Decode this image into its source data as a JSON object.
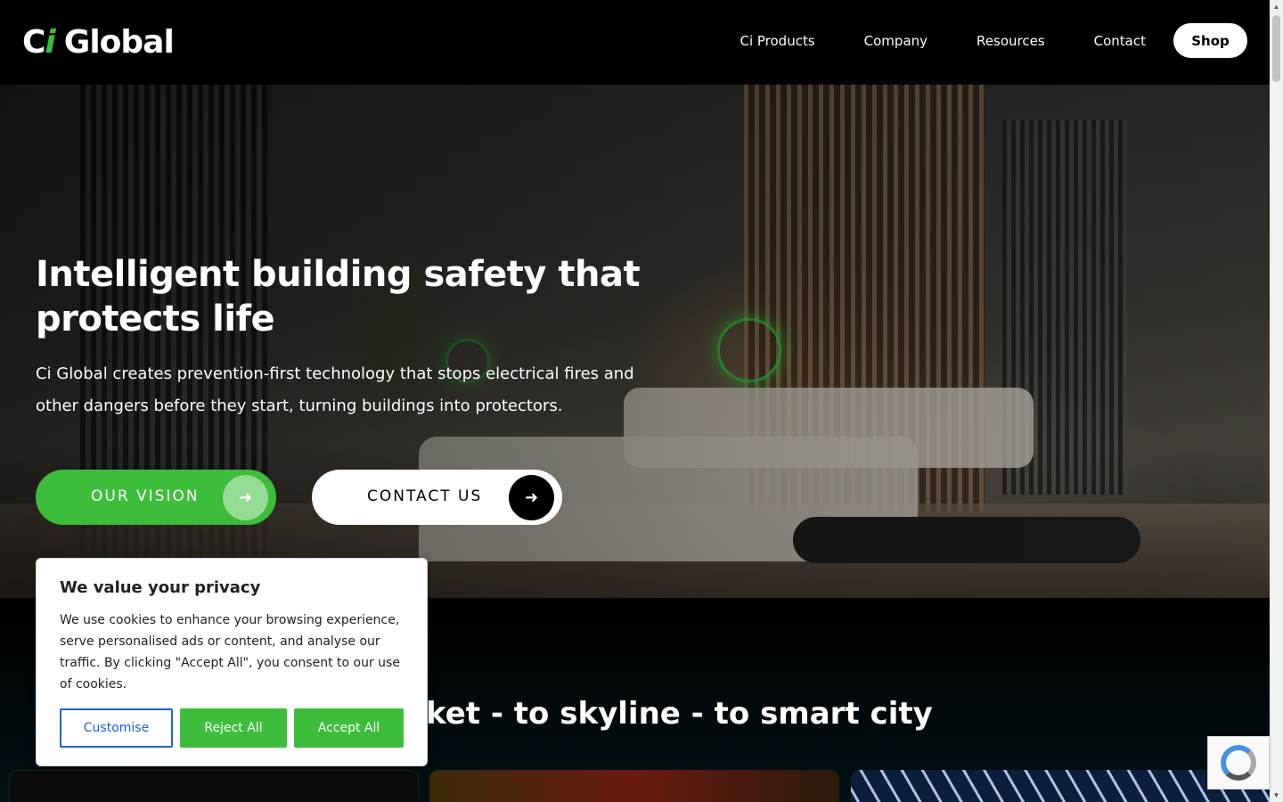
{
  "header": {
    "logo_text": "Ci Global",
    "nav": [
      "Ci Products",
      "Company",
      "Resources",
      "Contact"
    ],
    "shop_label": "Shop"
  },
  "hero": {
    "title": "Intelligent building safety that protects life",
    "subtitle": "Ci Global creates prevention-first technology that stops electrical fires and other dangers before they start, turning buildings into protectors.",
    "vision_label": "OUR VISION",
    "contact_label": "CONTACT US",
    "arrow_icon": "arrow-right-icon"
  },
  "section": {
    "title_partial": "n socket - to skyline - to smart city"
  },
  "cookie": {
    "title": "We value your privacy",
    "text": "We use cookies to enhance your browsing experience, serve personalised ads or content, and analyse our traffic. By clicking \"Accept All\", you consent to our use of cookies.",
    "customise": "Customise",
    "reject": "Reject All",
    "accept": "Accept All"
  },
  "colors": {
    "brand_green": "#3dbd3b",
    "link_blue": "#1863dc",
    "header_bg": "#000000"
  }
}
